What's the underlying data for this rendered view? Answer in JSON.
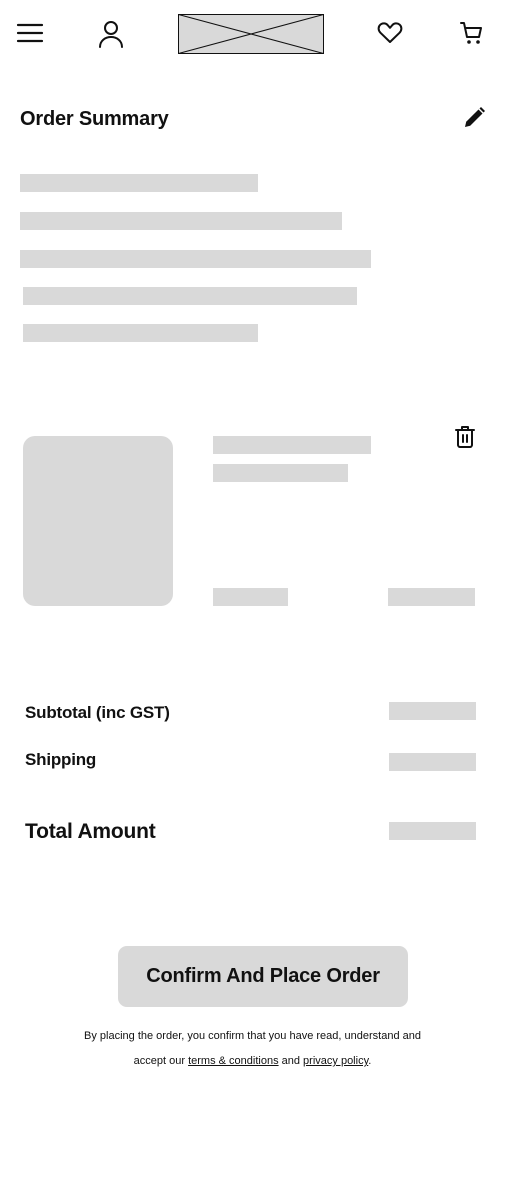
{
  "header": {
    "menu_icon": "hamburger-menu-icon",
    "account_icon": "user-icon",
    "logo": "logo-placeholder",
    "wishlist_icon": "heart-icon",
    "cart_icon": "cart-icon"
  },
  "order_summary": {
    "title": "Order Summary",
    "edit_icon": "pencil-icon"
  },
  "cart_item": {
    "delete_icon": "trash-icon"
  },
  "totals": {
    "subtotal_label": "Subtotal (inc GST)",
    "shipping_label": "Shipping",
    "total_label": "Total Amount"
  },
  "cta": {
    "label": "Confirm And Place Order"
  },
  "legal": {
    "line1": "By placing the order, you confirm that you have read, understand and",
    "prefix": "accept our ",
    "terms_link": "terms & conditions",
    "middle": " and ",
    "privacy_link": "privacy policy",
    "suffix": "."
  }
}
